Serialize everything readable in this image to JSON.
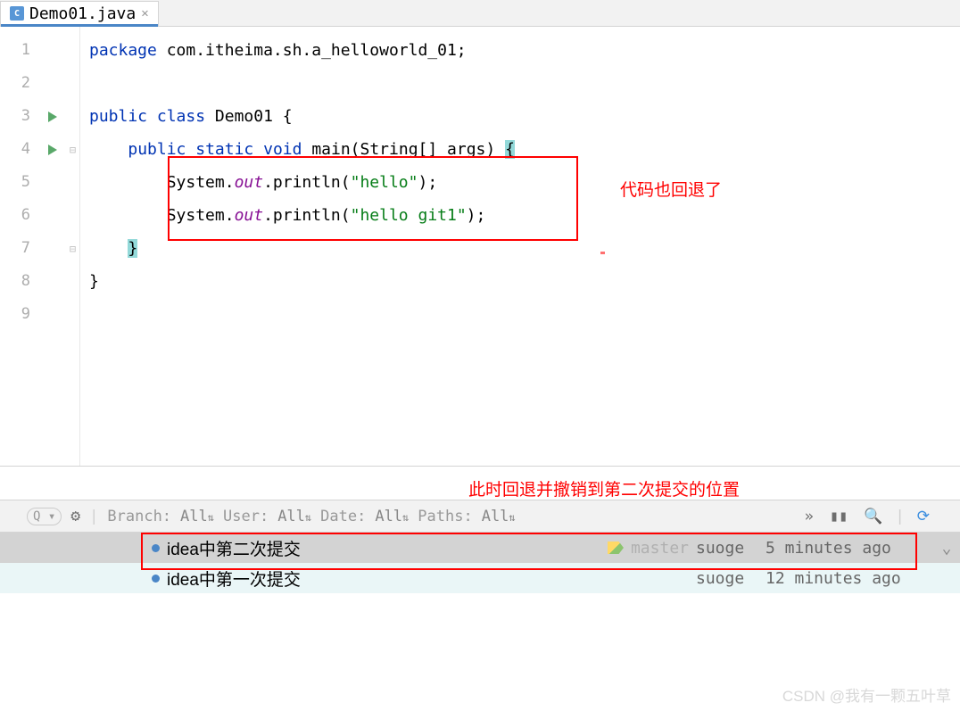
{
  "tab": {
    "filename": "Demo01.java",
    "icon_letter": "C"
  },
  "code": {
    "line1": {
      "kw1": "package",
      "rest": " com.itheima.sh.a_helloworld_01;"
    },
    "line3": {
      "kw1": "public",
      "kw2": "class",
      "cls": " Demo01 {"
    },
    "line4": {
      "kw1": "public",
      "kw2": "static",
      "kw3": "void",
      "fn": "main",
      "params": "(String[] args) ",
      "brace": "{"
    },
    "line5": {
      "pre": "System.",
      "fld": "out",
      "mid": ".println(",
      "str": "\"hello\"",
      "end": ");"
    },
    "line6": {
      "pre": "System.",
      "fld": "out",
      "mid": ".println(",
      "str": "\"hello git1\"",
      "end": ");"
    },
    "line7": {
      "brace": "}"
    },
    "line8": {
      "brace": "}"
    }
  },
  "line_numbers": [
    "1",
    "2",
    "3",
    "4",
    "5",
    "6",
    "7",
    "8",
    "9"
  ],
  "annotations": {
    "top": "代码也回退了",
    "bottom": "此时回退并撤销到第二次提交的位置"
  },
  "toolbar": {
    "branch_label": "Branch:",
    "branch_val": "All",
    "user_label": "User:",
    "user_val": "All",
    "date_label": "Date:",
    "date_val": "All",
    "paths_label": "Paths:",
    "paths_val": "All",
    "more": "»"
  },
  "commits": [
    {
      "msg": "idea中第二次提交",
      "branch": "master",
      "author": "suoge",
      "time": "5 minutes ago",
      "selected": true,
      "has_tag": true
    },
    {
      "msg": "idea中第一次提交",
      "branch": "",
      "author": "suoge",
      "time": "12 minutes ago",
      "selected": false,
      "has_tag": false
    }
  ],
  "watermark": "CSDN @我有一颗五叶草"
}
